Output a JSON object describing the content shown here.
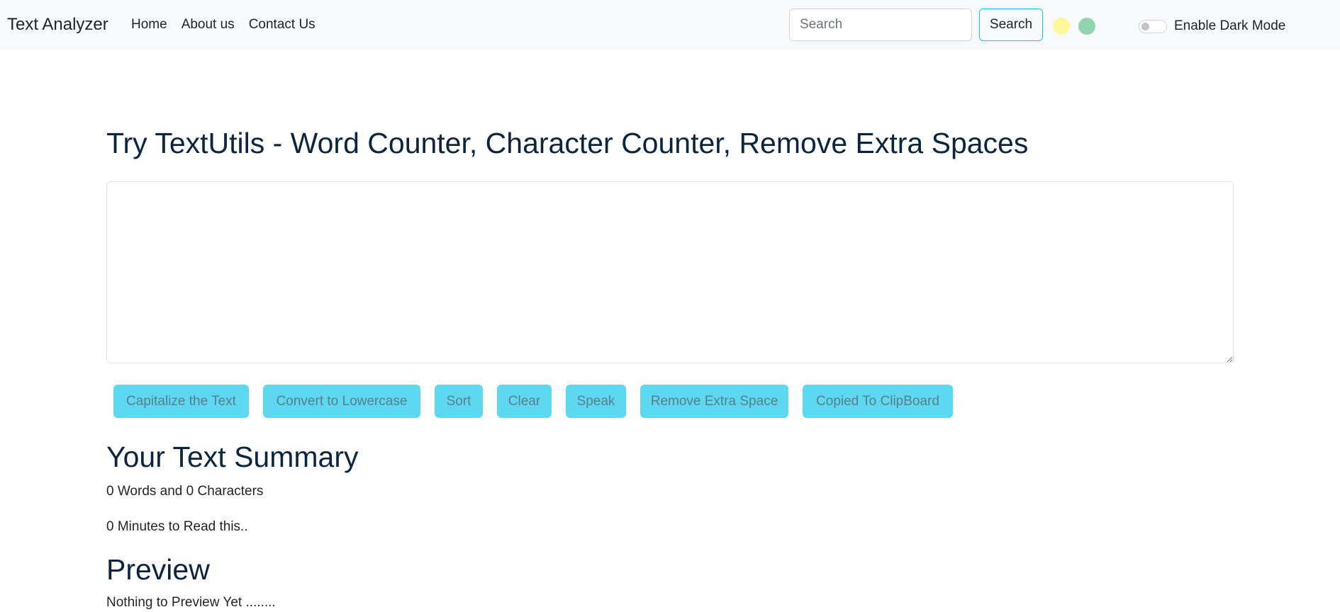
{
  "navbar": {
    "brand": "Text Analyzer",
    "links": [
      "Home",
      "About us",
      "Contact Us"
    ],
    "search": {
      "placeholder": "Search",
      "value": "",
      "button_label": "Search"
    },
    "color_swatches": [
      {
        "name": "yellow",
        "color": "#fff89a"
      },
      {
        "name": "green",
        "color": "#90d4b0"
      }
    ],
    "dark_mode": {
      "label": "Enable Dark Mode",
      "enabled": false
    }
  },
  "main": {
    "heading": "Try TextUtils - Word Counter, Character Counter, Remove Extra Spaces",
    "textarea_value": "",
    "buttons": [
      "Capitalize the Text",
      "Convert to Lowercase",
      "Sort",
      "Clear",
      "Speak",
      "Remove Extra Space",
      "Copied To ClipBoard"
    ]
  },
  "summary": {
    "title": "Your Text Summary",
    "counts": "0 Words and 0 Characters",
    "read_time": "0 Minutes to Read this.."
  },
  "preview": {
    "title": "Preview",
    "text": "Nothing to Preview Yet ........"
  },
  "colors": {
    "navbar_bg": "#f8f9fa",
    "heading": "#0b2540",
    "button_bg": "#5ed8f1",
    "search_button_border": "#0dcaf0"
  }
}
